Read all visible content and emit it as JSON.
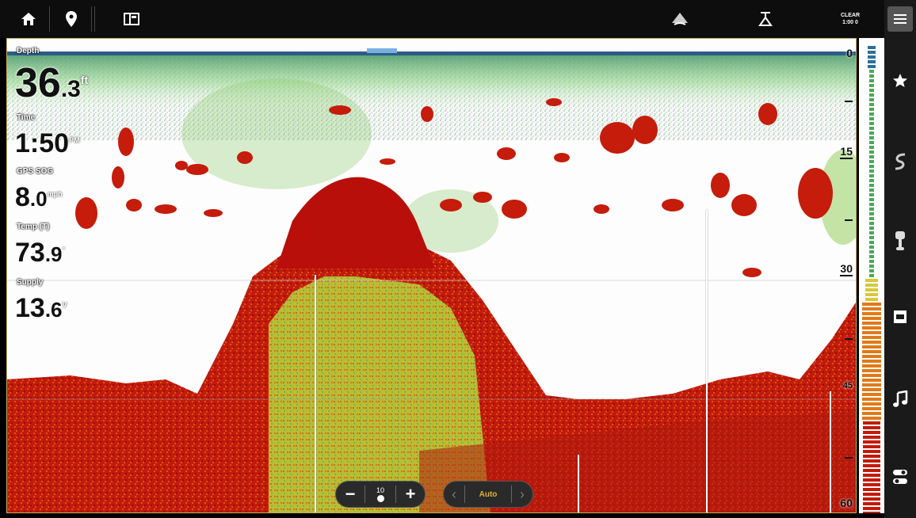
{
  "topbar": {
    "home_icon": "home-icon",
    "waypoint_icon": "map-pin-icon",
    "view_icon": "split-view-icon",
    "sonar_icon": "transducer-icon",
    "anchor_icon": "trolling-motor-icon",
    "status_line1": "CLEAR",
    "status_line2": "1:00 0",
    "menu_icon": "menu-icon"
  },
  "readouts": {
    "depth": {
      "label": "Depth",
      "int": "36",
      "dec": ".3",
      "unit": "ft"
    },
    "time": {
      "label": "Time",
      "int": "1:50",
      "dec": "",
      "unit": "PM"
    },
    "speed": {
      "label": "GPS SOG",
      "int": "8",
      "dec": ".0",
      "unit": "mph"
    },
    "temp": {
      "label": "Temp (T)",
      "int": "73",
      "dec": ".9",
      "unit": "°"
    },
    "supply": {
      "label": "Supply",
      "int": "13",
      "dec": ".6",
      "unit": "V"
    }
  },
  "depth_scale": {
    "t0": "0",
    "t15": "15",
    "t30": "30",
    "t45": "45",
    "t60": "60"
  },
  "zoom_control": {
    "minus": "−",
    "level": "10",
    "plus": "+"
  },
  "mode_control": {
    "left": "‹",
    "label": "Auto",
    "right": "›"
  },
  "rightrail": [
    "star-icon",
    "sonar-chart-icon",
    "trolling-motor-icon",
    "data-box-icon",
    "music-note-icon",
    "toggle-icon"
  ],
  "colors": {
    "bottom": "#b00d0d",
    "fish": "#c41a0a",
    "mid": "#d7c43a",
    "weak": "#6fd06a",
    "bg": "#ffffff"
  }
}
